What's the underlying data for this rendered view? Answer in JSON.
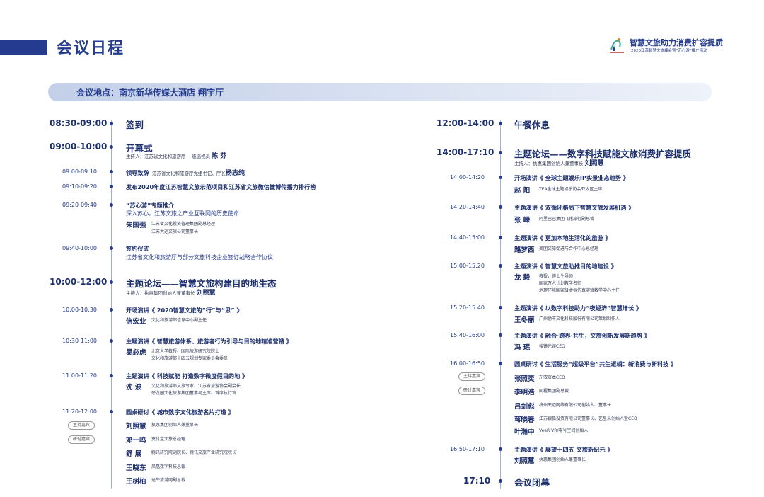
{
  "header": {
    "title": "会议日程",
    "brand_title": "智慧文旅助力消费扩容提质",
    "brand_subtitle": "2020江苏智慧文旅峰会暨“苏心游”推广活动"
  },
  "venue": "会议地点：南京新华传媒大酒店 翔宇厅",
  "left": {
    "signin": {
      "time": "08:30-09:00",
      "title": "签到"
    },
    "opening": {
      "time": "09:00-10:00",
      "title": "开幕式",
      "host_prefix": "主持人：江苏省文化和旅游厅 一级巡视员",
      "host_name": "陈 芬"
    },
    "s1": {
      "time": "09:00-09:10",
      "title": "领导致辞",
      "desc": "江苏省文化和旅游厅党组书记、厅长",
      "name": "杨志纯"
    },
    "s2": {
      "time": "09:10-09:20",
      "title": "发布2020年度江苏智慧文旅示范项目和江苏省文旅微信微博传播力排行榜"
    },
    "s3": {
      "time": "09:20-09:40",
      "title": "“苏心游”专题推介",
      "subtitle": "深入苏心，江苏文旅之产业互联网的历史使命",
      "name": "朱国强",
      "role1": "江苏省文化投资管理集团副总经理",
      "role2": "江苏大运文旅公司董事长"
    },
    "s4": {
      "time": "09:40-10:00",
      "title": "签约仪式",
      "subtitle": "江苏省文化和旅游厅与部分文旅科技企业签订战略合作协议"
    },
    "forum": {
      "time": "10:00-12:00",
      "title": "主题论坛——智慧文旅构建目的地生态",
      "host_prefix": "主持人：执惠集团创始人兼董事长",
      "host_name": "刘照慧"
    },
    "s5": {
      "time": "10:00-10:30",
      "title": "开场演讲《 2020智慧文旅的“行”与“思” 》",
      "name": "信宏业",
      "role": "文化和旅游部信息中心副主任"
    },
    "s6": {
      "time": "10:30-11:00",
      "title": "主题演讲《 智慧旅游体系、旅游者行为引导与目的地精准营销 》",
      "name": "吴必虎",
      "role1": "北京大学教授、国际旅游研究院院士",
      "role2": "文化和旅游部十四五规划专家委员会委员"
    },
    "s7": {
      "time": "11:00-11:20",
      "title": "主题演讲《 科技赋能 打造数字微度假目的地 》",
      "name": "沈 波",
      "role1": "文化和旅游部文旅专家、江苏省旅游协会副会长",
      "role2": "恐龙园文化旅游集团董事局主席、首席执行官"
    },
    "s8": {
      "time": "11:20-12:00",
      "title": "圆桌研讨《 城市数字文化旅游名片打造 》",
      "tag_host": "主持嘉宾",
      "tag_guest": "研讨嘉宾",
      "people": [
        {
          "name": "刘照慧",
          "role": "执惠集团创始人兼董事长"
        },
        {
          "name": "邓一鸣",
          "role": "支付宝文旅总经理"
        },
        {
          "name": "舒 展",
          "role": "腾讯研究院副院长、腾讯文旅产业研究院院长"
        },
        {
          "name": "王晓东",
          "role": "凤凰数字科技总裁"
        },
        {
          "name": "王树柏",
          "role": "途牛旅游网副总裁"
        }
      ]
    }
  },
  "right": {
    "lunch": {
      "time": "12:00-14:00",
      "title": "午餐休息"
    },
    "forum": {
      "time": "14:00-17:10",
      "title": "主题论坛——数字科技赋能文旅消费扩容提质",
      "host_prefix": "主持人：执惠集团创始人兼董事长",
      "host_name": "刘照慧"
    },
    "r1": {
      "time": "14:00-14:20",
      "title": "开场演讲《 全球主题娱乐IP实景业态趋势 》",
      "name": "赵 阳",
      "role": "TEA全球主题娱乐协会亚太区主席"
    },
    "r2": {
      "time": "14:20-14:40",
      "title": "主题演讲《 双循环格局下智慧文旅发展机遇 》",
      "name": "张 嵘",
      "role": "阿里巴巴集团飞猪旅行副总裁"
    },
    "r3": {
      "time": "14:40-15:00",
      "title": "主题演讲《 更加本地生活化的旅游 》",
      "name": "路梦西",
      "role": "美团文旅促进与合作中心总经理"
    },
    "r4": {
      "time": "15:00-15:20",
      "title": "主题演讲《 智慧文旅助推目的地建设 》",
      "name": "龙 毅",
      "role1": "教授，博士生导师",
      "role2": "国家万人计划教学名师",
      "role3": "地理环境国家级虚拟仿真实验教学中心主任"
    },
    "r5": {
      "time": "15:20-15:40",
      "title": "主题演讲《 以数字科技助力“夜经济”智慧增长 》",
      "name": "王冬丽",
      "role": "广州励丰文化科技股份有限公司策划制作人"
    },
    "r6": {
      "time": "15:40-16:00",
      "title": "主题演讲《 融合·跨界·共生，文旅创新发展新趋势 》",
      "name": "冯 珉",
      "role": "棱镜光娱CEO"
    },
    "r7": {
      "time": "16:00-16:50",
      "title": "圆桌研讨《 生活服务“超级平台”共生逻辑：新消费与新科技 》",
      "tag_host": "主持嘉宾",
      "tag_guest": "研讨嘉宾",
      "people": [
        {
          "name": "张照奕",
          "role": "左驭资本CEO"
        },
        {
          "name": "李明浩",
          "role": "同程集团副总裁"
        },
        {
          "name": "吕剑彪",
          "role": "杭州天迈网络有限公司创始人、董事长"
        },
        {
          "name": "蒋晓春",
          "role": "江苏银狐投资有限公司董事长、艺星米创始人暨CEO"
        },
        {
          "name": "叶瀚中",
          "role": "VeeR VR/零号空间创始人"
        }
      ]
    },
    "r8": {
      "time": "16:50-17:10",
      "title": "主题演讲《 展望十四五 文旅新纪元 》",
      "name": "刘照慧",
      "role": "执惠集团创始人兼董事长"
    },
    "close": {
      "time": "17:10",
      "title": "会议闭幕"
    }
  }
}
